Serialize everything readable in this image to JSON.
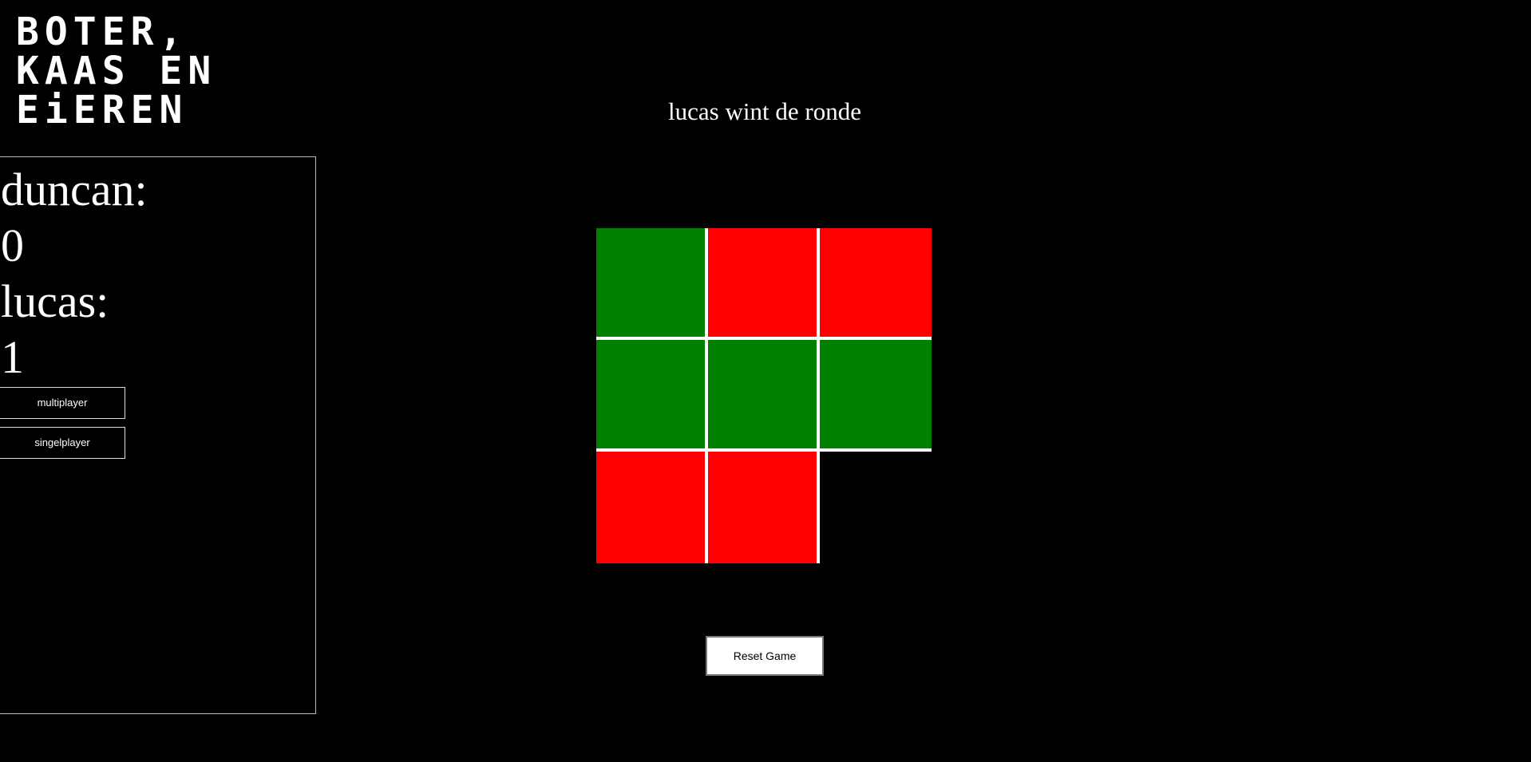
{
  "title": {
    "line1": "BOTER,",
    "line2": "KAAS EN",
    "line3": "EiEREN"
  },
  "status_text": "lucas wint de ronde",
  "scoreboard": {
    "player1_label": "duncan:",
    "player1_score": "0",
    "player2_label": "lucas:",
    "player2_score": "1"
  },
  "mode_buttons": {
    "multiplayer": "multiplayer",
    "singleplayer": "singelplayer"
  },
  "board": {
    "cells": [
      "green",
      "red",
      "red",
      "green",
      "green",
      "green",
      "red",
      "red",
      "empty"
    ],
    "colors": {
      "green": "#008000",
      "red": "#ff0000",
      "empty": "#000000",
      "grid": "#ffffff"
    }
  },
  "reset_button": "Reset Game"
}
